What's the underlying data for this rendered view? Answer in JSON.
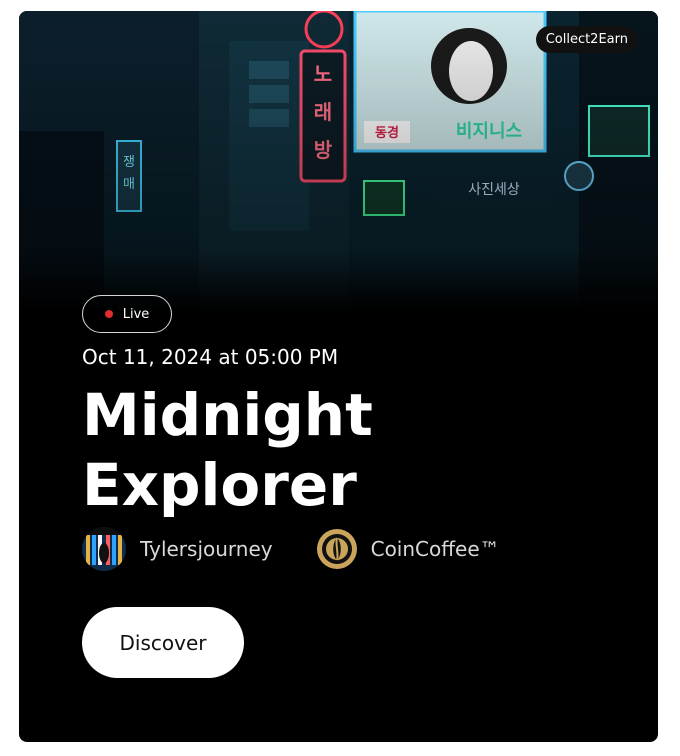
{
  "card": {
    "tag": "Collect2Earn",
    "status": "Live",
    "date": "Oct 11, 2024 at 05:00 PM",
    "title_line1": "Midnight",
    "title_line2": "Explorer",
    "creator": "Tylersjourney",
    "brand": "CoinCoffee™",
    "cta": "Discover"
  },
  "hero": {
    "signs": [
      "노래방",
      "비지니스",
      "동경",
      "사진세상",
      "쟁매"
    ]
  },
  "colors": {
    "accent_live": "#e02d2d",
    "background": "#000000",
    "button_bg": "#ffffff",
    "coin_gold": "#c9a45a"
  },
  "icons": [
    "live-dot-icon",
    "avatar-image",
    "coin-coffee-logo-icon"
  ]
}
